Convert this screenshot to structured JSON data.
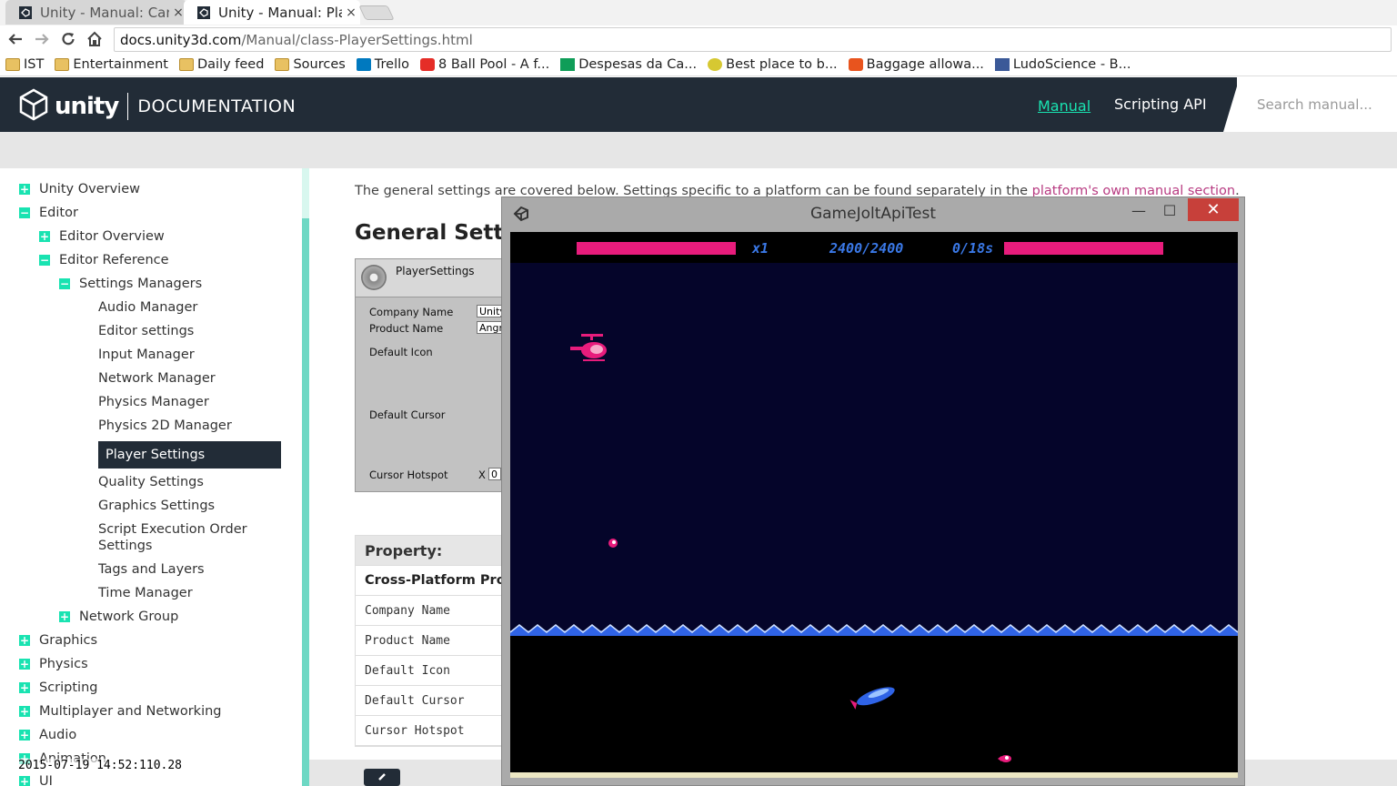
{
  "browser": {
    "tabs": [
      {
        "title": "Unity - Manual: Canv",
        "close": "×"
      },
      {
        "title": "Unity - Manual: Playe",
        "close": "×"
      }
    ],
    "url_domain": "docs.unity3d.com",
    "url_path": "/Manual/class-PlayerSettings.html",
    "bookmarks": [
      {
        "label": "IST",
        "icon": "folder-icon"
      },
      {
        "label": "Entertainment",
        "icon": "folder-icon"
      },
      {
        "label": "Daily feed",
        "icon": "folder-icon"
      },
      {
        "label": "Sources",
        "icon": "folder-icon"
      },
      {
        "label": "Trello",
        "icon": "trello-icon"
      },
      {
        "label": "8 Ball Pool - A f...",
        "icon": "youtube-icon"
      },
      {
        "label": "Despesas da Ca...",
        "icon": "sheets-icon"
      },
      {
        "label": "Best place to b...",
        "icon": "smiley-icon"
      },
      {
        "label": "Baggage allowa...",
        "icon": "e-icon"
      },
      {
        "label": "LudoScience - B...",
        "icon": "facebook-icon"
      }
    ]
  },
  "site": {
    "logo_word": "unity",
    "logo_doc": "DOCUMENTATION",
    "nav_manual": "Manual",
    "nav_scripting": "Scripting API",
    "search_placeholder": "Search manual...",
    "accent": "#19e3b1",
    "header_bg": "#222c37"
  },
  "sidebar": {
    "items": [
      {
        "label": "Unity Overview",
        "toggle": "+"
      },
      {
        "label": "Editor",
        "toggle": "−"
      },
      {
        "label": "Editor Overview",
        "toggle": "+"
      },
      {
        "label": "Editor Reference",
        "toggle": "−"
      },
      {
        "label": "Settings Managers",
        "toggle": "−"
      },
      {
        "label": "Audio Manager"
      },
      {
        "label": "Editor settings"
      },
      {
        "label": "Input Manager"
      },
      {
        "label": "Network Manager"
      },
      {
        "label": "Physics Manager"
      },
      {
        "label": "Physics 2D Manager"
      },
      {
        "label": "Player Settings"
      },
      {
        "label": "Quality Settings"
      },
      {
        "label": "Graphics Settings"
      },
      {
        "label": "Script Execution Order"
      },
      {
        "label": "Settings"
      },
      {
        "label": "Tags and Layers"
      },
      {
        "label": "Time Manager"
      },
      {
        "label": "Network Group",
        "toggle": "+"
      },
      {
        "label": "Graphics",
        "toggle": "+"
      },
      {
        "label": "Physics",
        "toggle": "+"
      },
      {
        "label": "Scripting",
        "toggle": "+"
      },
      {
        "label": "Multiplayer and Networking",
        "toggle": "+"
      },
      {
        "label": "Audio",
        "toggle": "+"
      },
      {
        "label": "Animation",
        "toggle": "+"
      },
      {
        "label": "UI",
        "toggle": "+"
      }
    ]
  },
  "content": {
    "intro_text": "The general settings are covered below. Settings specific to a platform can be found separately in the ",
    "intro_link": "platform's own manual section",
    "intro_end": ".",
    "heading": "General Settin",
    "inspector": {
      "title": "PlayerSettings",
      "company_label": "Company Name",
      "company_value": "Unity",
      "product_label": "Product Name",
      "product_value": "Angr",
      "icon_label": "Default Icon",
      "cursor_label": "Default Cursor",
      "hotspot_label": "Cursor Hotspot",
      "hotspot_x": "X",
      "hotspot_value": "0"
    },
    "table": {
      "header": "Property:",
      "section": "Cross-Platform Prope",
      "rows": [
        "Company Name",
        "Product Name",
        "Default Icon",
        "Default Cursor",
        "Cursor Hotspot"
      ]
    }
  },
  "game_window": {
    "title": "GameJoltApiTest",
    "minimize": "—",
    "maximize": "☐",
    "close": "✕",
    "hud": {
      "lives": "x1",
      "health": "2400/2400",
      "timer": "0/18s"
    },
    "colors": {
      "sky": "#05052a",
      "bar": "#e81c7c",
      "hud_text": "#3a78e6"
    }
  },
  "overlay": {
    "timestamp": "2015-07-19 14:52:110.28"
  }
}
